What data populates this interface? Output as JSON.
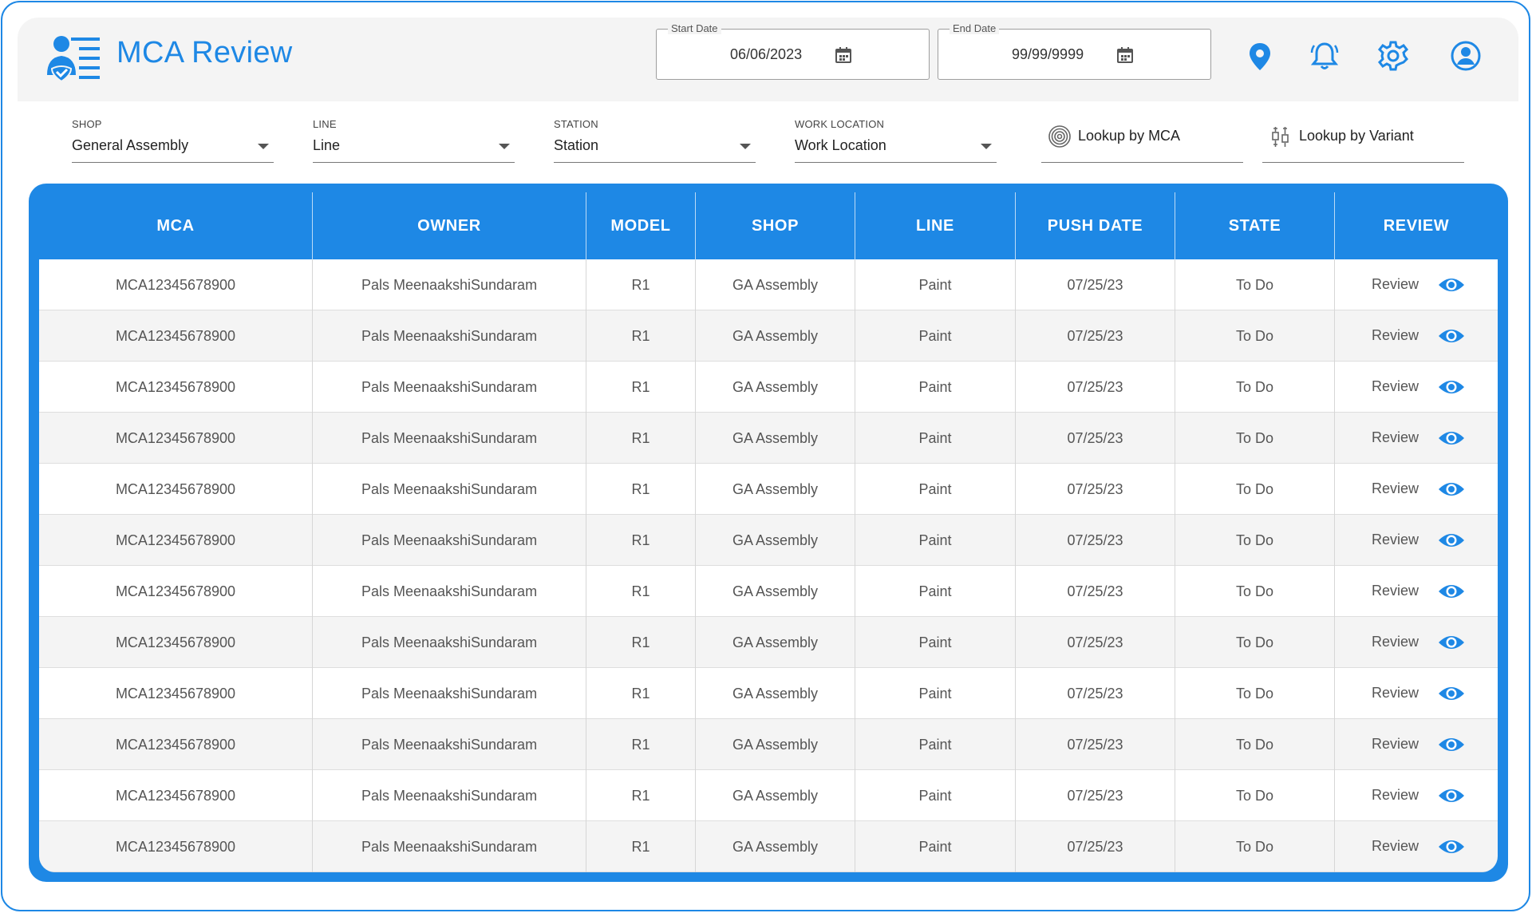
{
  "app": {
    "title": "MCA Review"
  },
  "dates": {
    "start": {
      "label": "Start Date",
      "value": "06/06/2023"
    },
    "end": {
      "label": "End Date",
      "value": "99/99/9999"
    }
  },
  "filters": [
    {
      "label": "SHOP",
      "value": "General Assembly"
    },
    {
      "label": "LINE",
      "value": "Line"
    },
    {
      "label": "STATION",
      "value": "Station"
    },
    {
      "label": "WORK LOCATION",
      "value": "Work Location"
    }
  ],
  "lookups": {
    "mca": {
      "label": "Lookup by MCA",
      "icon": "fingerprint-icon"
    },
    "variant": {
      "label": "Lookup by Variant",
      "icon": "variant-icon"
    }
  },
  "header_icons": [
    "location-pin-icon",
    "notification-bell-icon",
    "settings-gear-icon",
    "user-account-icon"
  ],
  "table": {
    "columns": [
      "MCA",
      "OWNER",
      "MODEL",
      "SHOP",
      "LINE",
      "PUSH DATE",
      "STATE",
      "REVIEW"
    ],
    "rows": [
      [
        "MCA12345678900",
        "Pals MeenaakshiSundaram",
        "R1",
        "GA Assembly",
        "Paint",
        "07/25/23",
        "To Do",
        "Review"
      ],
      [
        "MCA12345678900",
        "Pals MeenaakshiSundaram",
        "R1",
        "GA Assembly",
        "Paint",
        "07/25/23",
        "To Do",
        "Review"
      ],
      [
        "MCA12345678900",
        "Pals MeenaakshiSundaram",
        "R1",
        "GA Assembly",
        "Paint",
        "07/25/23",
        "To Do",
        "Review"
      ],
      [
        "MCA12345678900",
        "Pals MeenaakshiSundaram",
        "R1",
        "GA Assembly",
        "Paint",
        "07/25/23",
        "To Do",
        "Review"
      ],
      [
        "MCA12345678900",
        "Pals MeenaakshiSundaram",
        "R1",
        "GA Assembly",
        "Paint",
        "07/25/23",
        "To Do",
        "Review"
      ],
      [
        "MCA12345678900",
        "Pals MeenaakshiSundaram",
        "R1",
        "GA Assembly",
        "Paint",
        "07/25/23",
        "To Do",
        "Review"
      ],
      [
        "MCA12345678900",
        "Pals MeenaakshiSundaram",
        "R1",
        "GA Assembly",
        "Paint",
        "07/25/23",
        "To Do",
        "Review"
      ],
      [
        "MCA12345678900",
        "Pals MeenaakshiSundaram",
        "R1",
        "GA Assembly",
        "Paint",
        "07/25/23",
        "To Do",
        "Review"
      ],
      [
        "MCA12345678900",
        "Pals MeenaakshiSundaram",
        "R1",
        "GA Assembly",
        "Paint",
        "07/25/23",
        "To Do",
        "Review"
      ],
      [
        "MCA12345678900",
        "Pals MeenaakshiSundaram",
        "R1",
        "GA Assembly",
        "Paint",
        "07/25/23",
        "To Do",
        "Review"
      ],
      [
        "MCA12345678900",
        "Pals MeenaakshiSundaram",
        "R1",
        "GA Assembly",
        "Paint",
        "07/25/23",
        "To Do",
        "Review"
      ],
      [
        "MCA12345678900",
        "Pals MeenaakshiSundaram",
        "R1",
        "GA Assembly",
        "Paint",
        "07/25/23",
        "To Do",
        "Review"
      ]
    ]
  },
  "colors": {
    "accent": "#1e88e5",
    "header_bg": "#f4f4f4",
    "row_alt": "#f4f4f4",
    "text": "#555555"
  }
}
